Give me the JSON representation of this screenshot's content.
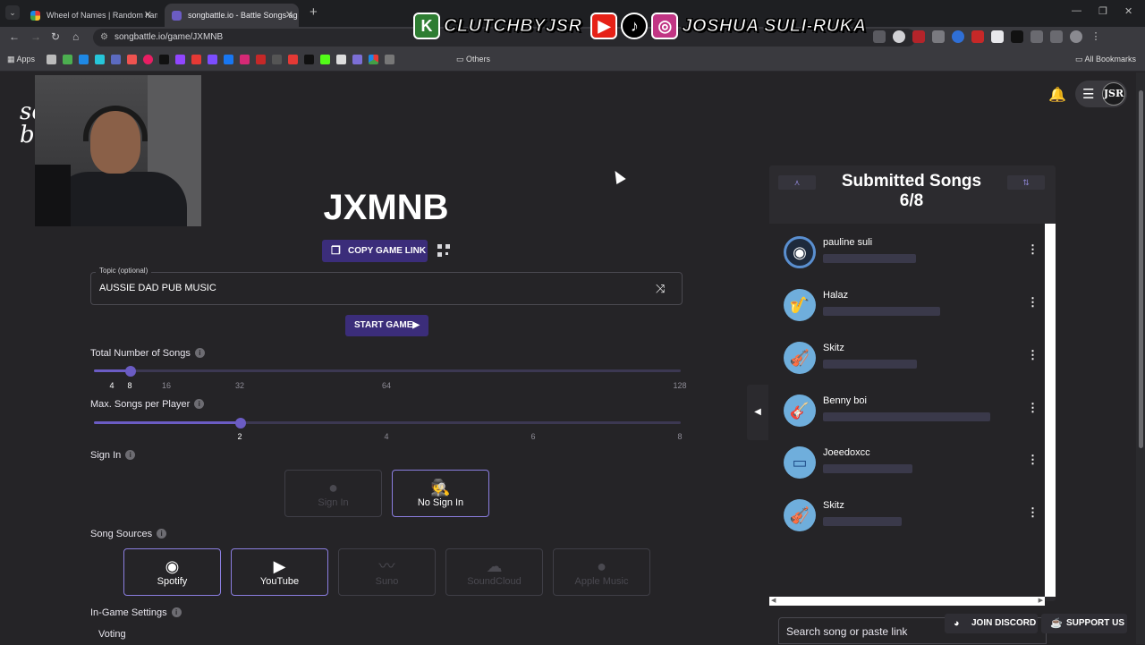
{
  "browser": {
    "tabs": [
      {
        "title": "Wheel of Names | Random nam",
        "close": "✕"
      },
      {
        "title": "songbattle.io - Battle Songs ag",
        "close": "✕"
      }
    ],
    "new_tab": "+",
    "url": "songbattle.io/game/JXMNB",
    "bookmarks_apps": "Apps",
    "bookmarks_others": "Others",
    "bookmarks_all": "All Bookmarks"
  },
  "stream_banner": {
    "handle1": "CLUTCHBYJSR",
    "handle2": "JOSHUA SULI-RUKA"
  },
  "site": {
    "logo_fragment_1": "so",
    "logo_fragment_2": "b",
    "avatar_initials": "JSR"
  },
  "game": {
    "code": "JXMNB",
    "copy_link_label": "COPY GAME LINK",
    "topic_label": "Topic (optional)",
    "topic_value": "AUSSIE DAD PUB MUSIC",
    "start_label": "START GAME"
  },
  "settings": {
    "total_songs": {
      "label": "Total Number of Songs",
      "ticks": [
        "4",
        "8",
        "16",
        "32",
        "64",
        "128"
      ],
      "selected": "8",
      "fraction": 0.062
    },
    "max_per_player": {
      "label": "Max. Songs per Player",
      "ticks": [
        "2",
        "4",
        "6",
        "8"
      ],
      "selected": "2",
      "fraction": 0.25
    },
    "sign_in": {
      "label": "Sign In",
      "options": [
        {
          "label": "Sign In",
          "icon": "person-icon",
          "active": false
        },
        {
          "label": "No Sign In",
          "icon": "incognito-icon",
          "active": true
        }
      ]
    },
    "song_sources": {
      "label": "Song Sources",
      "options": [
        {
          "label": "Spotify",
          "icon": "spotify-icon",
          "active": true
        },
        {
          "label": "YouTube",
          "icon": "youtube-icon",
          "active": true
        },
        {
          "label": "Suno",
          "icon": "suno-icon",
          "active": false
        },
        {
          "label": "SoundCloud",
          "icon": "soundcloud-icon",
          "active": false
        },
        {
          "label": "Apple Music",
          "icon": "apple-icon",
          "active": false
        }
      ]
    },
    "in_game": {
      "label": "In-Game Settings",
      "voting_label": "Voting"
    }
  },
  "submitted": {
    "title": "Submitted Songs",
    "count": "6/8",
    "songs": [
      {
        "name": "pauline suli",
        "icon": "vinyl-icon"
      },
      {
        "name": "Halaz",
        "icon": "saxophone-icon"
      },
      {
        "name": "Skitz",
        "icon": "violin-icon"
      },
      {
        "name": "Benny boi",
        "icon": "guitar-icon"
      },
      {
        "name": "Joeedoxcc",
        "icon": "harmonica-icon"
      },
      {
        "name": "Skitz",
        "icon": "violin-icon"
      }
    ],
    "search_placeholder": "Search song or paste link"
  },
  "footer": {
    "discord_label": "JOIN DISCORD",
    "support_label": "SUPPORT US"
  },
  "colors": {
    "accent": "#6b5cc4",
    "button": "#3b2d7a",
    "background": "#252427",
    "panel": "#2c2b2f"
  }
}
